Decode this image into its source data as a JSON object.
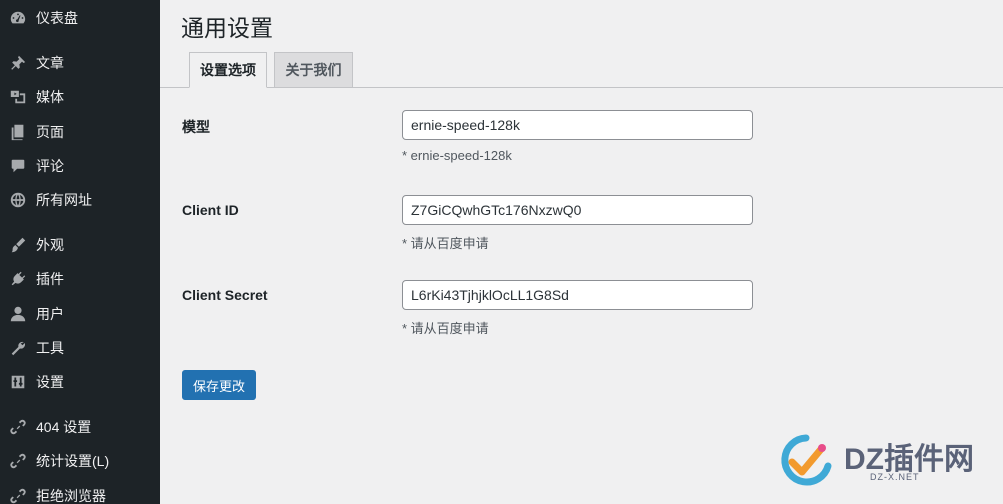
{
  "sidebar": {
    "items": [
      {
        "label": "仪表盘",
        "icon": "dashboard-icon"
      },
      {
        "label": "文章",
        "icon": "pin-icon"
      },
      {
        "label": "媒体",
        "icon": "media-icon"
      },
      {
        "label": "页面",
        "icon": "page-icon"
      },
      {
        "label": "评论",
        "icon": "comment-icon"
      },
      {
        "label": "所有网址",
        "icon": "globe-icon"
      },
      {
        "label": "外观",
        "icon": "brush-icon"
      },
      {
        "label": "插件",
        "icon": "plugin-icon"
      },
      {
        "label": "用户",
        "icon": "user-icon"
      },
      {
        "label": "工具",
        "icon": "wrench-icon"
      },
      {
        "label": "设置",
        "icon": "settings-icon"
      },
      {
        "label": "404 设置",
        "icon": "link-icon"
      },
      {
        "label": "统计设置(L)",
        "icon": "link-icon"
      },
      {
        "label": "拒绝浏览器",
        "icon": "link-icon"
      }
    ]
  },
  "page": {
    "title": "通用设置"
  },
  "tabs": [
    {
      "label": "设置选项",
      "active": true
    },
    {
      "label": "关于我们",
      "active": false
    }
  ],
  "fields": [
    {
      "label": "模型",
      "value": "ernie-speed-128k",
      "description": "* ernie-speed-128k"
    },
    {
      "label": "Client ID",
      "value": "Z7GiCQwhGTc176NxzwQ0",
      "description": "* 请从百度申请"
    },
    {
      "label": "Client Secret",
      "value": "L6rKi43TjhjklOcLL1G8Sd",
      "description": "* 请从百度申请"
    }
  ],
  "save_button": {
    "label": "保存更改"
  },
  "watermark": {
    "text": "DZ插件网",
    "subtext": "DZ-X.NET"
  },
  "colors": {
    "sidebar_bg": "#1d2327",
    "page_bg": "#f0f0f1",
    "primary": "#2271b1"
  }
}
